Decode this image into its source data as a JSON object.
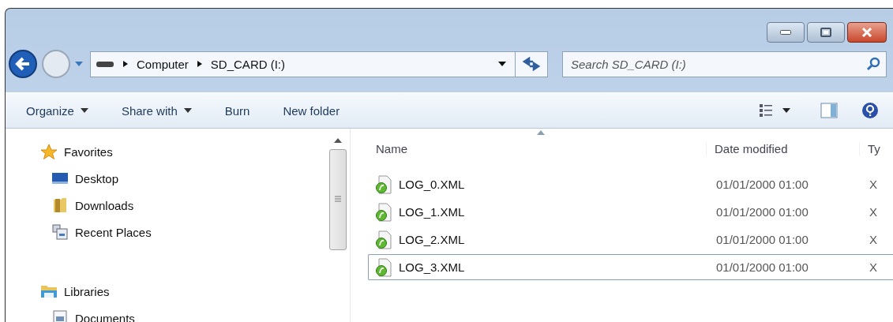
{
  "address_bar": {
    "path": [
      "Computer",
      "SD_CARD (I:)"
    ]
  },
  "search": {
    "placeholder": "Search SD_CARD (I:)"
  },
  "toolbar": {
    "buttons": [
      {
        "label": "Organize",
        "dropdown": true
      },
      {
        "label": "Share with",
        "dropdown": true
      },
      {
        "label": "Burn",
        "dropdown": false
      },
      {
        "label": "New folder",
        "dropdown": false
      }
    ]
  },
  "navigation": [
    {
      "label": "Favorites",
      "kind": "star",
      "children": [
        {
          "label": "Desktop",
          "kind": "desktop"
        },
        {
          "label": "Downloads",
          "kind": "folder"
        },
        {
          "label": "Recent Places",
          "kind": "recent"
        }
      ]
    },
    {
      "label": "Libraries",
      "kind": "libraries",
      "children": [
        {
          "label": "Documents",
          "kind": "document"
        }
      ]
    }
  ],
  "file_list": {
    "columns": [
      "Name",
      "Date modified",
      "Ty"
    ],
    "rows": [
      {
        "name": "LOG_0.XML",
        "date": "01/01/2000 01:00",
        "type": "X",
        "focused": false
      },
      {
        "name": "LOG_1.XML",
        "date": "01/01/2000 01:00",
        "type": "X",
        "focused": false
      },
      {
        "name": "LOG_2.XML",
        "date": "01/01/2000 01:00",
        "type": "X",
        "focused": false
      },
      {
        "name": "LOG_3.XML",
        "date": "01/01/2000 01:00",
        "type": "X",
        "focused": true
      }
    ]
  }
}
